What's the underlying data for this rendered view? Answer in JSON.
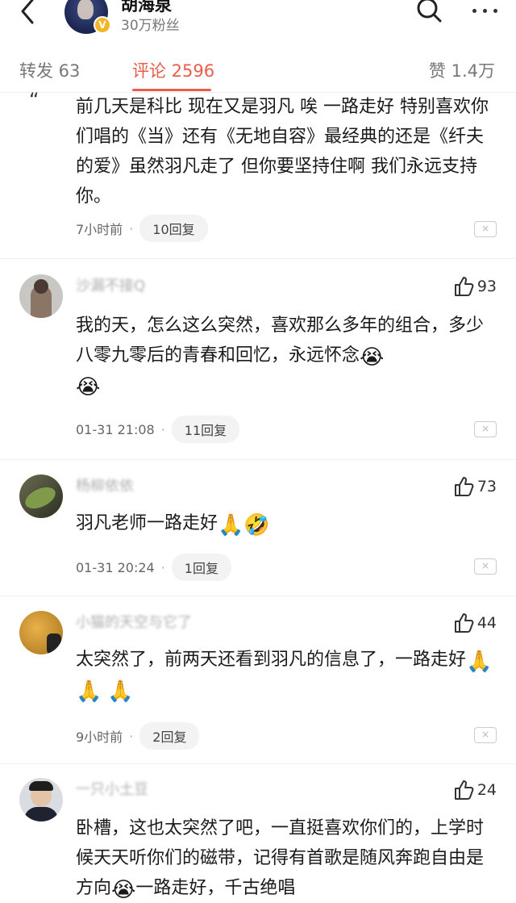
{
  "header": {
    "user_name": "胡海泉",
    "followers": "30万粉丝",
    "verified_badge": "V"
  },
  "tabs": {
    "repost": "转发 63",
    "comments": "评论 2596",
    "likes": "赞 1.4万"
  },
  "comments": [
    {
      "name": "",
      "text": "前几天是科比 现在又是羽凡 唉 一路走好 特别喜欢你们唱的《当》还有《无地自容》最经典的还是《纤夫的爱》虽然羽凡走了 但你要坚持住啊 我们永远支持你。",
      "time": "7小时前",
      "replies": "10回复",
      "likes": ""
    },
    {
      "name": "沙漏不接Q",
      "text": "我的天，怎么这么突然，喜欢那么多年的组合，多少八零九零后的青春和回忆，永远怀念",
      "time": "01-31 21:08",
      "replies": "11回复",
      "likes": "93"
    },
    {
      "name": "杨柳依依",
      "text": "羽凡老师一路走好",
      "time": "01-31 20:24",
      "replies": "1回复",
      "likes": "73"
    },
    {
      "name": "小猫的天空与它了",
      "text": "太突然了，前两天还看到羽凡的信息了，一路走好",
      "time": "9小时前",
      "replies": "2回复",
      "likes": "44"
    },
    {
      "name": "一只小土豆",
      "text": "卧槽，这也太突然了吧，一直挺喜欢你们的，上学时候天天听你们的磁带，记得有首歌是随风奔跑自由是方向",
      "text_tail": "一路走好，千古绝唱",
      "time": "",
      "replies": "",
      "likes": "24"
    }
  ],
  "close_glyph": "×",
  "colors": {
    "accent": "#ea5c4a",
    "muted": "#777777",
    "pill_bg": "#f3f3f3"
  },
  "icons": [
    "back-arrow-icon",
    "search-icon",
    "more-icon",
    "thumbs-up-icon",
    "crying-emoji",
    "praying-hands-emoji",
    "laughing-emoji"
  ]
}
